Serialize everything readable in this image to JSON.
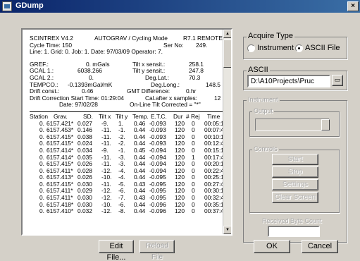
{
  "window": {
    "title": "GDump",
    "close_glyph": "×"
  },
  "textpane": {
    "lines": [
      [
        "SCINTREX V4.2",
        "AUTOGRAV / Cycling Mode",
        "R7.1 REMOTE"
      ],
      [
        "Cycle Time:   150",
        "Ser No:",
        "249."
      ],
      [
        "Line:   1.  Grid:   0.  Job:   1.  Date: 97/03/09  Operator:   7."
      ],
      [],
      [
        "GREF.:",
        "0. mGals",
        "Tilt x sensit.:",
        "258.1"
      ],
      [
        "GCAL 1.:",
        "6038.266",
        "Tilt y sensit.:",
        "247.8"
      ],
      [
        "GCAL 2.:",
        "0.",
        "Deg.Lat.:",
        "70.3"
      ],
      [
        "TEMPCO.:",
        "-0.1393mGal/mK",
        "Deg.Long.:",
        "148.5"
      ],
      [
        "Drift const.:",
        "0.46",
        "GMT Difference:",
        "0.hr"
      ],
      [
        "Drift Correction Start  Time: 01:29:04",
        "Cal.after x samples:",
        "12"
      ],
      [
        "Date: 97/02/28",
        "On-Line Tilt Corrected = \"*\""
      ]
    ],
    "columns": [
      "Station",
      "Grav.",
      "SD.",
      "Tilt x",
      "Tilt y",
      "Temp.",
      "E.T.C.",
      "Dur",
      "# Rej",
      "Time"
    ],
    "rows": [
      [
        "0.",
        "6157.421*",
        "0.027",
        "-9.",
        "1.",
        "0.46",
        "-0.093",
        "120",
        "0",
        "00:05:13"
      ],
      [
        "0.",
        "6157.453*",
        "0.146",
        "-11.",
        "-1.",
        "0.44",
        "-0.093",
        "120",
        "0",
        "00:07:43"
      ],
      [
        "0.",
        "6157.415*",
        "0.038",
        "-11.",
        "-2.",
        "0.44",
        "-0.093",
        "120",
        "0",
        "00:10:13"
      ],
      [
        "0.",
        "6157.415*",
        "0.024",
        "-11.",
        "-2.",
        "0.44",
        "-0.093",
        "120",
        "0",
        "00:12:43"
      ],
      [
        "0.",
        "6157.414*",
        "0.034",
        "-9.",
        "-1.",
        "0.45",
        "-0.094",
        "120",
        "0",
        "00:15:13"
      ],
      [
        "0.",
        "6157.414*",
        "0.035",
        "-11.",
        "-3.",
        "0.44",
        "-0.094",
        "120",
        "1",
        "00:17:43"
      ],
      [
        "0.",
        "6157.415*",
        "0.026",
        "-11.",
        "-3.",
        "0.44",
        "-0.094",
        "120",
        "0",
        "00:20:13"
      ],
      [
        "0.",
        "6157.411*",
        "0.028",
        "-12.",
        "-4.",
        "0.44",
        "-0.094",
        "120",
        "0",
        "00:22:43"
      ],
      [
        "0.",
        "6157.413*",
        "0.026",
        "-10.",
        "-4.",
        "0.44",
        "-0.095",
        "120",
        "0",
        "00:25:13"
      ],
      [
        "0.",
        "6157.415*",
        "0.030",
        "-11.",
        "-5.",
        "0.43",
        "-0.095",
        "120",
        "0",
        "00:27:43"
      ],
      [
        "0.",
        "6157.411*",
        "0.029",
        "-12.",
        "-6.",
        "0.44",
        "-0.095",
        "120",
        "0",
        "00:30:13"
      ],
      [
        "0.",
        "6157.411*",
        "0.030",
        "-12.",
        "-7.",
        "0.43",
        "-0.095",
        "120",
        "0",
        "00:32:43"
      ],
      [
        "0.",
        "6157.418*",
        "0.030",
        "-10.",
        "-6.",
        "0.44",
        "-0.096",
        "120",
        "0",
        "00:35:13"
      ],
      [
        "0.",
        "6157.410*",
        "0.032",
        "-12.",
        "-8.",
        "0.44",
        "-0.096",
        "120",
        "0",
        "00:37:43"
      ]
    ]
  },
  "acquire": {
    "label": "Acquire Type",
    "instrument_label": "Instrument",
    "ascii_label": "ASCII File",
    "selected": "ascii"
  },
  "ascii": {
    "label": "ASCII",
    "path": "D:\\A10Projects\\Pruc"
  },
  "instrument": {
    "label": "Instrument",
    "output_label": "Output",
    "controls_label": "Controls",
    "start_label": "Start",
    "stop_label": "Stop",
    "settings_label": "Settings",
    "clear_label": "Clear Screen",
    "byte_count_label": "Received Byte Count"
  },
  "buttons": {
    "edit_file": "Edit File...",
    "reload_file": "Reload File",
    "ok": "OK",
    "cancel": "Cancel"
  },
  "colors": {
    "titlebar_start": "#0a246a",
    "titlebar_end": "#3a6ea5",
    "dialog_bg": "#d4d0c8"
  }
}
